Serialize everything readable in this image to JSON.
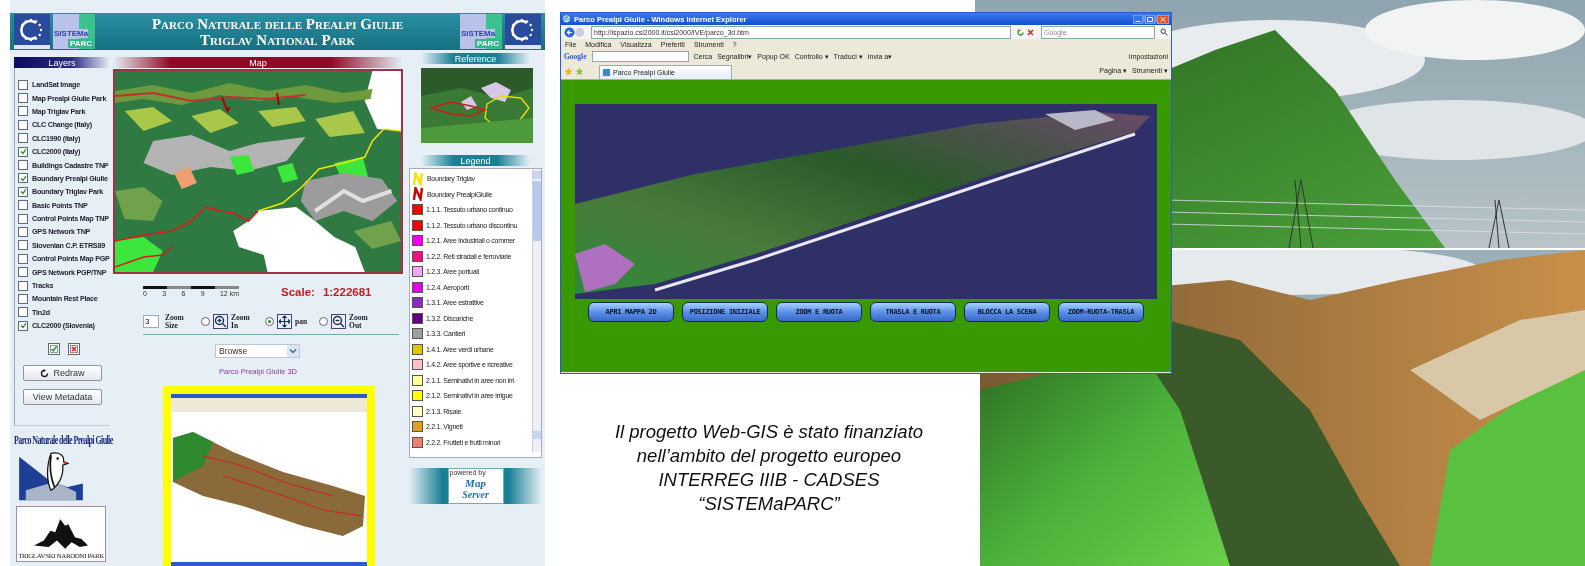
{
  "gis": {
    "logos": [
      {
        "line_1": "SISTEMa",
        "line_2": "PARC"
      },
      {
        "line_1": "SISTEMa",
        "line_2": "PARC"
      }
    ],
    "title_lines": [
      "Parco Naturale delle Prealpi Giulie",
      "Triglav National Park"
    ],
    "layers": {
      "title": "Layers",
      "items": [
        {
          "label": "LandSat Image",
          "checked": false
        },
        {
          "label": "Map Prealpi Giulie Park",
          "checked": false
        },
        {
          "label": "Map Triglav Park",
          "checked": false
        },
        {
          "label": "CLC Change (Italy)",
          "checked": false
        },
        {
          "label": "CLC1990 (Italy)",
          "checked": false
        },
        {
          "label": "CLC2000 (Italy)",
          "checked": true
        },
        {
          "label": "Buildings Cadastre TNP",
          "checked": false
        },
        {
          "label": "Boundary Prealpi Giulie",
          "checked": true
        },
        {
          "label": "Boundary Triglav Park",
          "checked": true
        },
        {
          "label": "Basic Points TNP",
          "checked": false
        },
        {
          "label": "Control Points Map TNP",
          "checked": false
        },
        {
          "label": "GPS Network TNP",
          "checked": false
        },
        {
          "label": "Slovenian C.P. ETRS89",
          "checked": false
        },
        {
          "label": "Control Points Map PGP",
          "checked": false
        },
        {
          "label": "GPS Network PGP/TNP",
          "checked": false
        },
        {
          "label": "Tracks",
          "checked": false
        },
        {
          "label": "Mountain Rest Place",
          "checked": false
        },
        {
          "label": "Tin2d",
          "checked": false
        },
        {
          "label": "CLC2000 (Slovenia)",
          "checked": true
        }
      ],
      "buttons": [
        "Redraw",
        "View Metadata"
      ]
    },
    "park_logos": {
      "prealpi": "Parco Naturale delle Prealpi Giulie",
      "triglav": "TRIGLAVSKI NARODNI PARK"
    },
    "map": {
      "title": "Map",
      "scale_ticks": [
        "0",
        "3",
        "6",
        "9",
        "12 km"
      ],
      "scale_label": "Scale:",
      "scale_value": "1:222681"
    },
    "tools": {
      "zoom_size": "3",
      "zoom_size_label": "Zoom Size",
      "modes": [
        {
          "kind": "zoom-in",
          "label": "Zoom In",
          "selected": false
        },
        {
          "kind": "pan",
          "label": "pan",
          "selected": true
        },
        {
          "kind": "zoom-out",
          "label": "Zoom Out",
          "selected": false
        }
      ]
    },
    "mode_select": "Browse",
    "link_3d": "Parco Prealpi Giulie 3D",
    "reference": {
      "title": "Reference"
    },
    "legend": {
      "title": "Legend",
      "items": [
        {
          "kind": "line",
          "label": "Boundary Triglav",
          "color": "#f2e600"
        },
        {
          "kind": "line",
          "label": "Boundary PrealpiGiulie",
          "color": "#cc0000"
        },
        {
          "kind": "fill",
          "label": "1.1.1. Tessuto urbano continuo",
          "color": "#ff0000"
        },
        {
          "kind": "fill",
          "label": "1.1.2. Tessuto urbano discontinu",
          "color": "#f00000"
        },
        {
          "kind": "fill",
          "label": "1.2.1. Aree industriali o commer",
          "color": "#ee00ee"
        },
        {
          "kind": "fill",
          "label": "1.2.2. Reti stradali e ferroviarie",
          "color": "#e6147f"
        },
        {
          "kind": "fill",
          "label": "1.2.3. Aree portuali",
          "color": "#f4a8f4"
        },
        {
          "kind": "fill",
          "label": "1.2.4. Aeroporti",
          "color": "#e600e6"
        },
        {
          "kind": "fill",
          "label": "1.3.1. Aree estrattive",
          "color": "#8a2bc0"
        },
        {
          "kind": "fill",
          "label": "1.3.2. Discariche",
          "color": "#5e0080"
        },
        {
          "kind": "fill",
          "label": "1.3.3. Cantieri",
          "color": "#a0a0a0"
        },
        {
          "kind": "fill",
          "label": "1.4.1. Aree verdi urbane",
          "color": "#e0c800"
        },
        {
          "kind": "fill",
          "label": "1.4.2. Aree sportive e ricreative",
          "color": "#ffc0c8"
        },
        {
          "kind": "fill",
          "label": "2.1.1. Seminativi in aree non irri",
          "color": "#ffff9c"
        },
        {
          "kind": "fill",
          "label": "2.1.2. Seminativi in aree irrigue",
          "color": "#ffff00"
        },
        {
          "kind": "fill",
          "label": "2.1.3. Risaie",
          "color": "#ffffc4"
        },
        {
          "kind": "fill",
          "label": "2.2.1. Vigneti",
          "color": "#e0a020"
        },
        {
          "kind": "fill",
          "label": "2.2.2. Frutteti e frutti minori",
          "color": "#f28070"
        }
      ]
    },
    "powered_by": {
      "line_1": "powered by",
      "line_2": "Map",
      "line_3": "Server"
    }
  },
  "browser": {
    "title": "Parco Prealpi Giulie - Windows Internet Explorer",
    "address": "http://ispazio.csi2000.it/csi2000/IVE/parco_3d.htm",
    "search_placeholder": "Google",
    "menu": [
      "File",
      "Modifica",
      "Visualizza",
      "Preferiti",
      "Strumenti",
      "?"
    ],
    "toolbar": [
      "Google",
      "Cerca",
      "Segnalibri▾",
      "Popup OK",
      "Controllo ▾",
      "Traduci ▾",
      "Invia a▾"
    ],
    "settings": "Impostazioni",
    "tab": "Parco Prealpi Giulie",
    "command_bar": [
      "Pagina ▾",
      "Strumenti ▾"
    ],
    "scene_buttons": [
      "APRI MAPPA 2D",
      "POSIZIONE INIZIALE",
      "ZOOM E RUOTA",
      "TRASLA E RUOTA",
      "BLOCCA LA SCENA",
      "ZOOM-RUOTA-TRASLA"
    ]
  },
  "caption": "Il progetto Web-GIS è stato finanziato nell’ambito del progetto europeo INTERREG IIIB - CADSES “SISTEMaPARC”"
}
